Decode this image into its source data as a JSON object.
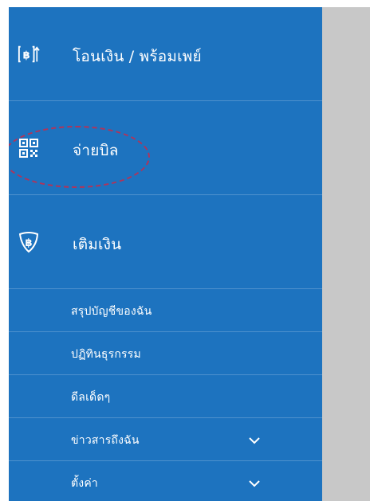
{
  "menu": {
    "transfer": {
      "label": "โอนเงิน / พร้อมเพย์",
      "icon": "transfer-baht-icon"
    },
    "pay_bill": {
      "label": "จ่ายบิล",
      "icon": "qr-code-icon"
    },
    "top_up": {
      "label": "เติมเงิน",
      "icon": "topup-baht-shield-icon"
    },
    "account_summary": {
      "label": "สรุปบัญชีของฉัน"
    },
    "transactions": {
      "label": "ปฏิทินธุรกรรม"
    },
    "deals": {
      "label": "ดีลเด็ดๆ"
    },
    "news": {
      "label": "ข่าวสารถึงฉัน",
      "icon": "chevron-down-icon"
    },
    "settings": {
      "label": "ตั้งค่า",
      "icon": "chevron-down-icon"
    }
  },
  "colors": {
    "sidebar": "#1d73bf",
    "highlight": "#b0345a",
    "overlay": "#c8c8c8"
  }
}
